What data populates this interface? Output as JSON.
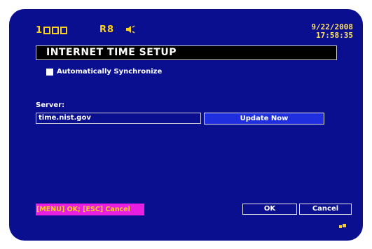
{
  "status": {
    "channel_number": "1",
    "channel_boxes": 3,
    "rec_label": "R8",
    "speaker_icon": "speaker-icon",
    "date": "9/22/2008",
    "time": "17:58:35"
  },
  "dialog": {
    "title": "INTERNET TIME SETUP",
    "auto_sync_label": "Automatically Synchronize",
    "auto_sync_checked": false,
    "server_label": "Server:",
    "server_value": "time.nist.gov",
    "update_now_label": "Update Now"
  },
  "footer": {
    "help_text": "[MENU] OK; [ESC] Cancel",
    "ok_label": "OK",
    "cancel_label": "Cancel"
  },
  "colors": {
    "background": "#0a0f90",
    "accent_yellow": "#ffd21a",
    "help_bar": "#e81ee0",
    "button_active": "#1f2fe0"
  }
}
